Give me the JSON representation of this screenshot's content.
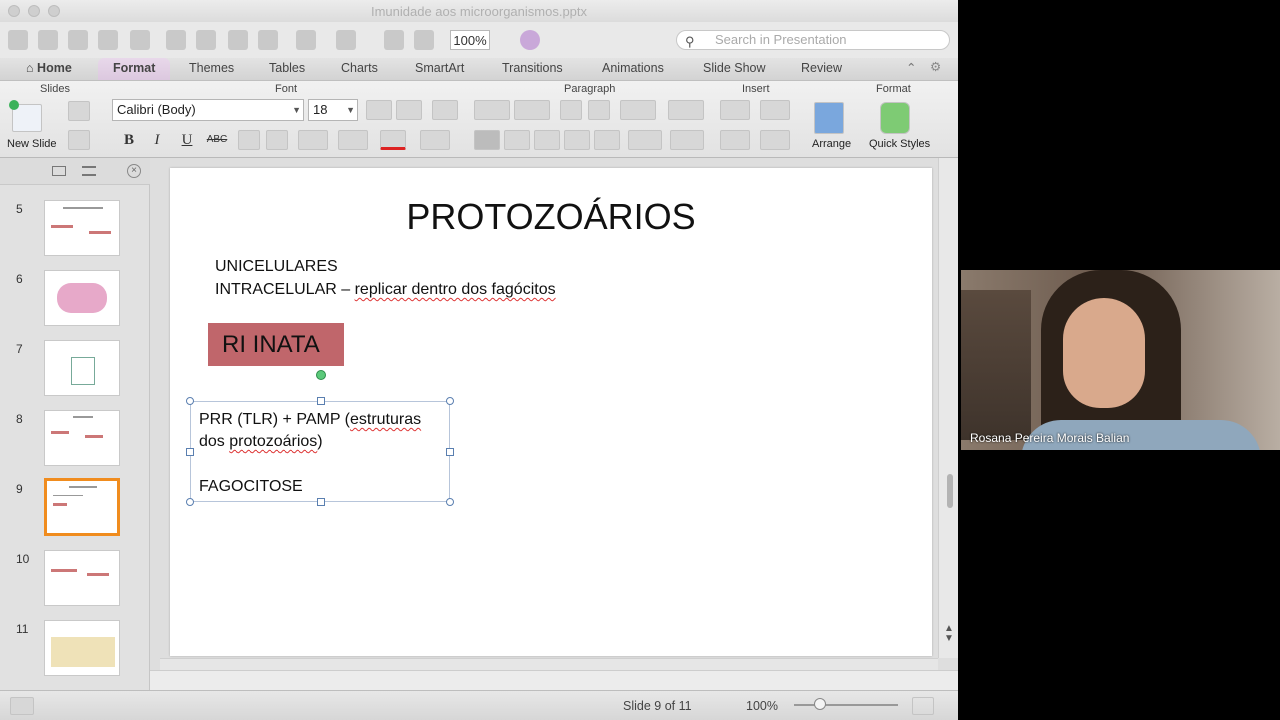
{
  "window": {
    "title": "Imunidade aos microorganismos.pptx"
  },
  "toolbar": {
    "zoom": "100%",
    "search_placeholder": "Search in Presentation"
  },
  "ribbon_tabs": [
    "Home",
    "Format",
    "Themes",
    "Tables",
    "Charts",
    "SmartArt",
    "Transitions",
    "Animations",
    "Slide Show",
    "Review"
  ],
  "ribbon": {
    "groups": {
      "slides": "Slides",
      "font": "Font",
      "paragraph": "Paragraph",
      "insert": "Insert",
      "format": "Format"
    },
    "new_slide": "New Slide",
    "font_name": "Calibri (Body)",
    "font_size": "18",
    "bold": "B",
    "italic": "I",
    "underline": "U",
    "strike": "ABC",
    "arrange": "Arrange",
    "quick_styles": "Quick Styles"
  },
  "thumbnails": [
    {
      "num": "5"
    },
    {
      "num": "6"
    },
    {
      "num": "7"
    },
    {
      "num": "8"
    },
    {
      "num": "9"
    },
    {
      "num": "10"
    },
    {
      "num": "11"
    }
  ],
  "slide": {
    "title": "PROTOZOÁRIOS",
    "line1": "UNICELULARES",
    "line2_a": "INTRACELULAR – ",
    "line2_b": "replicar dentro dos fagócitos",
    "badge": "RI INATA",
    "box_line1_a": "PRR (TLR) +  PAMP (",
    "box_line1_b": "estruturas",
    "box_line2_a": "dos ",
    "box_line2_b": "protozoários",
    "box_line2_c": ")",
    "box_line3": "FAGOCITOSE"
  },
  "status": {
    "slide_counter": "Slide 9 of 11",
    "zoom": "100%"
  },
  "video": {
    "participant_name": "Rosana Pereira Morais Balian"
  }
}
